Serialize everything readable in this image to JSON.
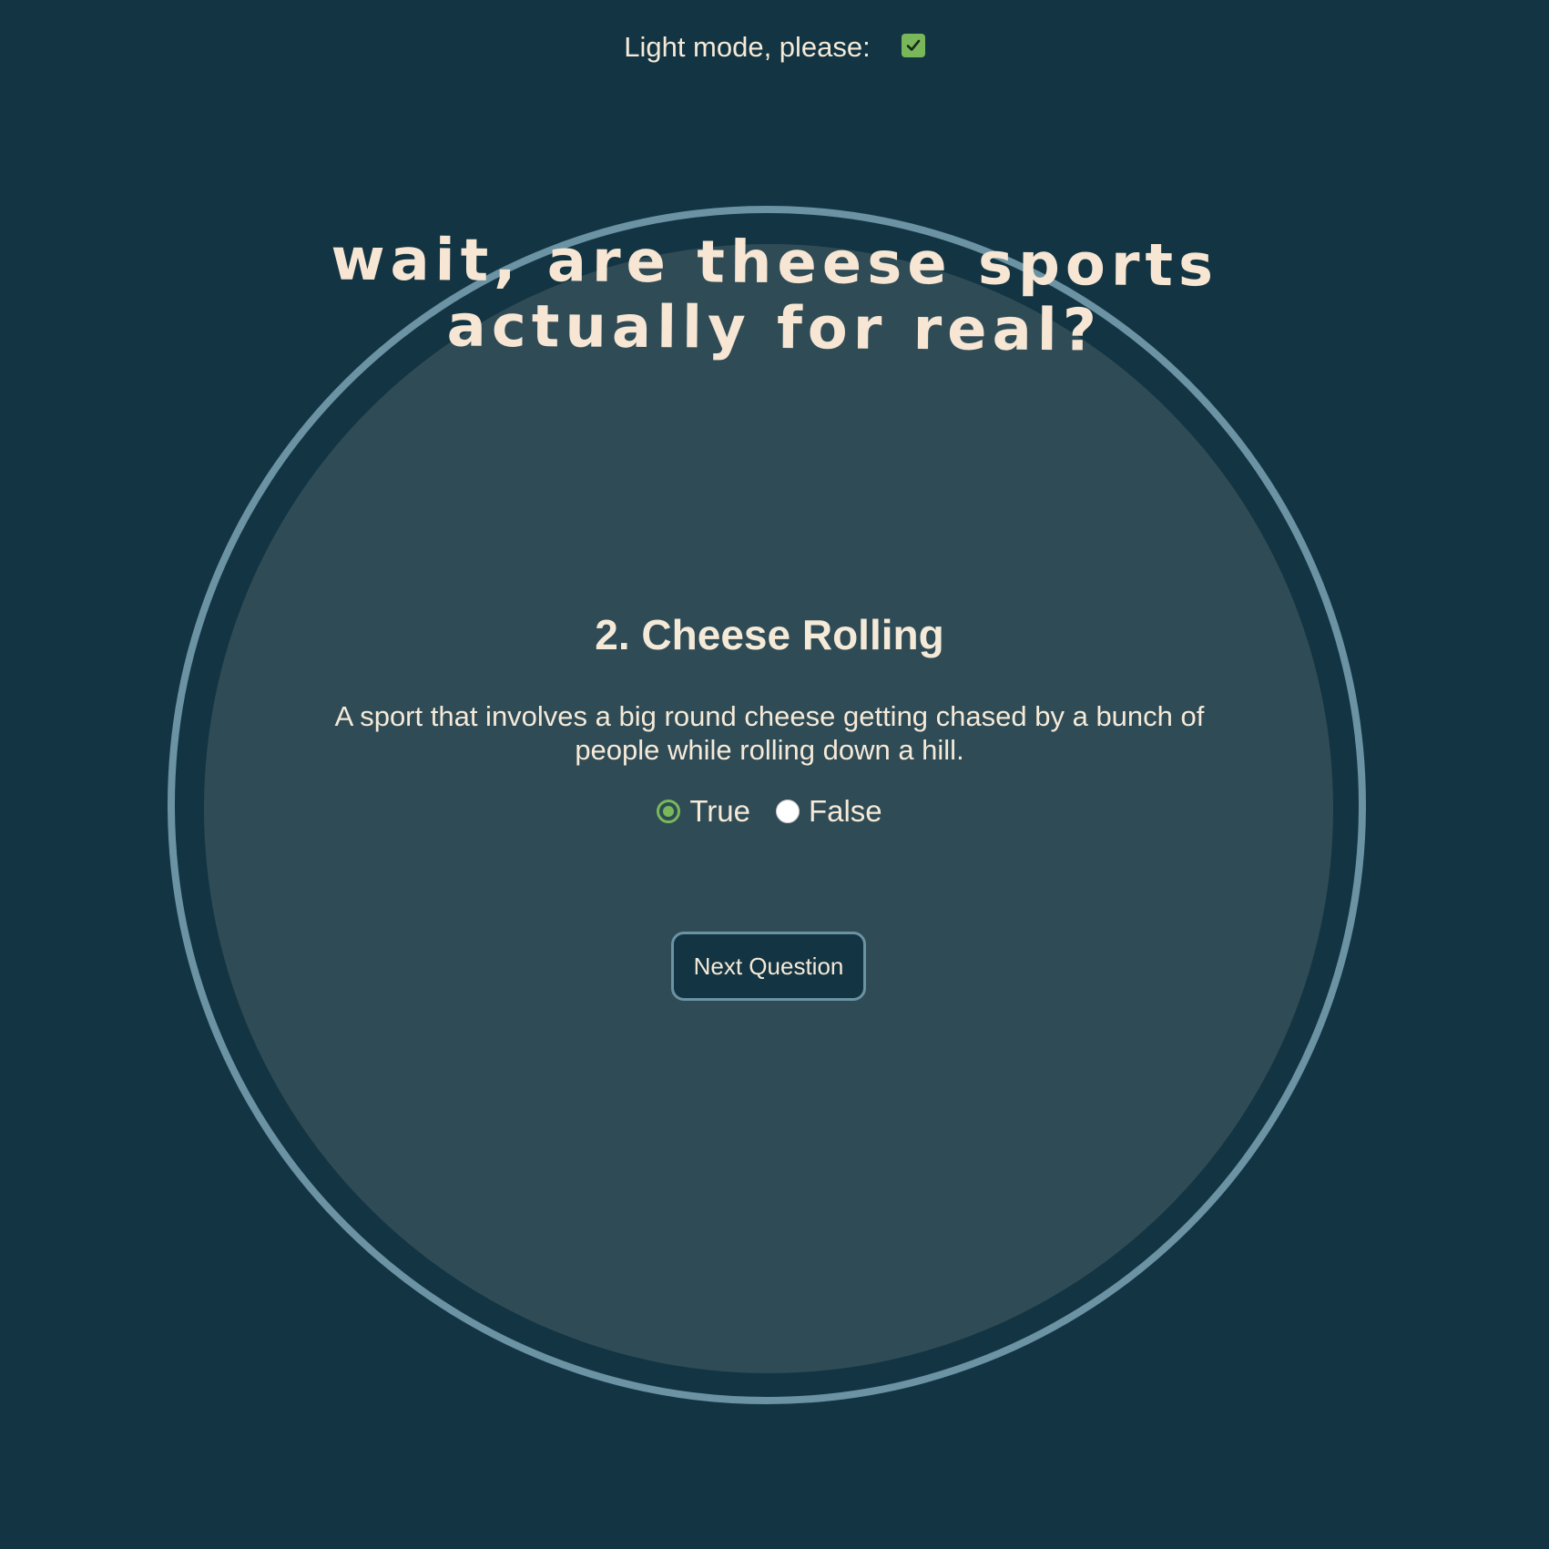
{
  "settings": {
    "light_mode_label": "Light mode, please:",
    "light_mode_checked": true
  },
  "header": {
    "title_line1": "wait, are theese sports",
    "title_line2": "actually for real?"
  },
  "question": {
    "title": "2. Cheese Rolling",
    "description": "A sport that involves a big round cheese getting chased by a bunch of people while rolling down a hill.",
    "options": [
      {
        "label": "True",
        "selected": true
      },
      {
        "label": "False",
        "selected": false
      }
    ]
  },
  "actions": {
    "next_label": "Next Question"
  },
  "colors": {
    "background": "#133442",
    "disc": "#2f4b56",
    "ring": "#6b93a3",
    "accent": "#79b85a",
    "text": "#f5ead8"
  }
}
